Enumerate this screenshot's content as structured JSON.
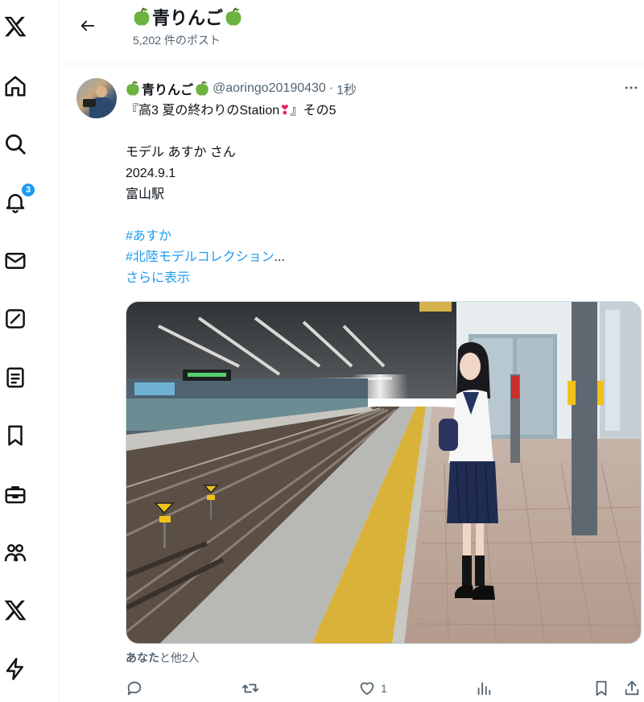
{
  "nav": {
    "notifications_badge": "3"
  },
  "header": {
    "title": "青りんご",
    "post_count": "5,202 件のポスト"
  },
  "tweet": {
    "display_name": "青りんご",
    "handle": "@aoringo20190430",
    "separator": "·",
    "time": "1秒",
    "line1_a": "『高3 夏の終わりのStation",
    "line1_excl": "❣",
    "line1_b": "』その5",
    "line2": "モデル あすか さん",
    "line3": "2024.9.1",
    "line4": "富山駅",
    "hashtag1": "#あすか",
    "hashtag2": "#北陸モデルコレクション",
    "ellipsis": "...",
    "show_more": "さらに表示",
    "liked_by_bold": "あなた",
    "liked_by_rest": "と他2人",
    "like_count": "1"
  },
  "colors": {
    "accent": "#1d9bf0",
    "text": "#0f1419",
    "secondary": "#536471",
    "apple_green": "#6cb33f"
  }
}
